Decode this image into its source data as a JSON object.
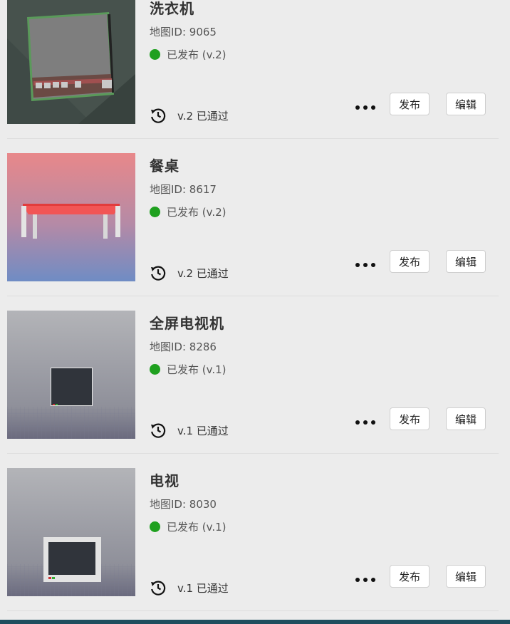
{
  "items": [
    {
      "title": "洗衣机",
      "map_id": "地图ID: 9065",
      "status": "已发布 (v.2)",
      "passed": "v.2 已通过",
      "thumb": "washing-machine"
    },
    {
      "title": "餐桌",
      "map_id": "地图ID: 8617",
      "status": "已发布 (v.2)",
      "passed": "v.2 已通过",
      "thumb": "dining-table"
    },
    {
      "title": "全屏电视机",
      "map_id": "地图ID: 8286",
      "status": "已发布 (v.1)",
      "passed": "v.1 已通过",
      "thumb": "fullscreen-tv"
    },
    {
      "title": "电视",
      "map_id": "地图ID: 8030",
      "status": "已发布 (v.1)",
      "passed": "v.1 已通过",
      "thumb": "tv"
    }
  ],
  "labels": {
    "publish": "发布",
    "edit": "编辑"
  },
  "colors": {
    "status_dot": "#1fa01f",
    "background": "#ececec",
    "bottom_bar": "#1e4e5e"
  },
  "icons": {
    "history": "history-clock-icon",
    "more": "more-dots-icon"
  }
}
